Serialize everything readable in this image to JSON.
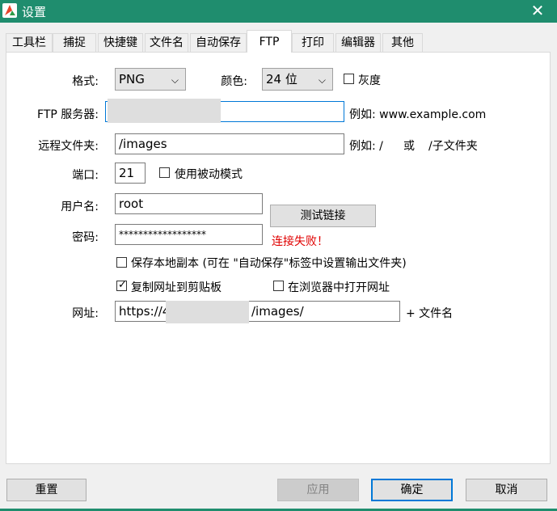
{
  "window": {
    "title": "设置",
    "close_glyph": "✕"
  },
  "tabs": [
    {
      "label": "工具栏"
    },
    {
      "label": "捕捉"
    },
    {
      "label": "快捷键"
    },
    {
      "label": "文件名"
    },
    {
      "label": "自动保存"
    },
    {
      "label": "FTP",
      "active": true
    },
    {
      "label": "打印"
    },
    {
      "label": "编辑器"
    },
    {
      "label": "其他"
    }
  ],
  "ftp": {
    "format_label": "格式:",
    "format_value": "PNG",
    "color_label": "颜色:",
    "color_value": "24 位",
    "gray_label": "灰度",
    "gray_checked": false,
    "server_label": "FTP 服务器:",
    "server_value": "",
    "server_example": "例如: www.example.com",
    "remote_label": "远程文件夹:",
    "remote_value": "/images",
    "remote_example_prefix": "例如: /",
    "remote_example_or": "或",
    "remote_example_sub": "/子文件夹",
    "port_label": "端口:",
    "port_value": "21",
    "passive_label": "使用被动模式",
    "passive_checked": false,
    "user_label": "用户名:",
    "user_value": "root",
    "password_label": "密码:",
    "password_value": "******************",
    "test_button": "测试链接",
    "status_text": "连接失败！",
    "save_local_label": "保存本地副本 (可在 \"自动保存\"标签中设置输出文件夹)",
    "save_local_checked": false,
    "copy_url_label": "复制网址到剪贴板",
    "copy_url_checked": true,
    "open_browser_label": "在浏览器中打开网址",
    "open_browser_checked": false,
    "url_label": "网址:",
    "url_prefix": "https://4",
    "url_suffix": "/images/",
    "url_append": "+ 文件名"
  },
  "footer": {
    "reset": "重置",
    "apply": "应用",
    "ok": "确定",
    "cancel": "取消"
  },
  "colors": {
    "titlebar": "#1f8d6e",
    "error": "#e00000",
    "focus": "#0078d7"
  }
}
